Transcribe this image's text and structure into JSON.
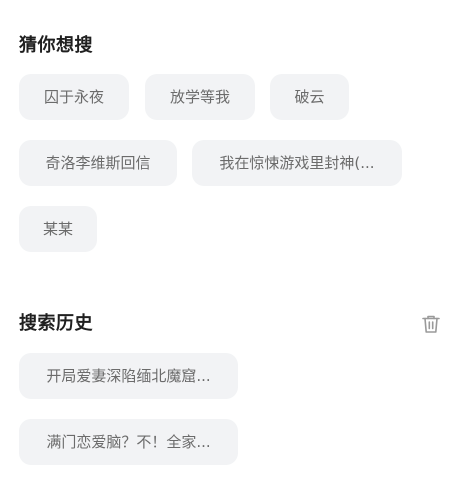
{
  "guess": {
    "title": "猜你想搜",
    "items": [
      {
        "label": "囚于永夜"
      },
      {
        "label": "放学等我"
      },
      {
        "label": "破云"
      },
      {
        "label": "奇洛李维斯回信"
      },
      {
        "label": "我在惊悚游戏里封神(..."
      },
      {
        "label": "某某"
      }
    ]
  },
  "history": {
    "title": "搜索历史",
    "clear_icon": "trash-icon",
    "items": [
      {
        "label": "开局爱妻深陷缅北魔窟..."
      },
      {
        "label": "满门恋爱脑？不！全家..."
      }
    ]
  },
  "colors": {
    "chip_bg": "#f2f3f5",
    "chip_text": "#6b6b6b",
    "title_text": "#1f1f1f",
    "icon": "#9a9a9a"
  }
}
